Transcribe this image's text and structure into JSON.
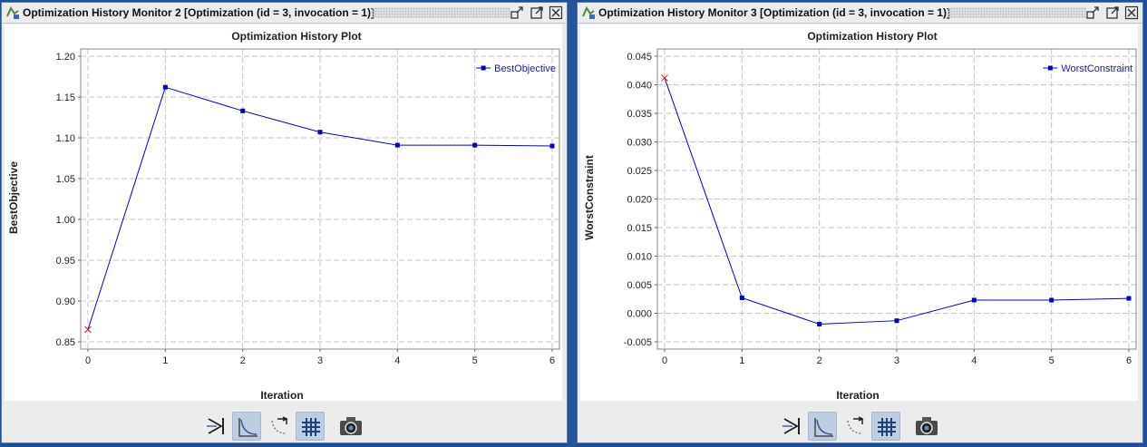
{
  "windows": [
    {
      "title": "Optimization History Monitor 2 [Optimization (id = 3, invocation = 1)]",
      "chart_data": {
        "type": "line",
        "title": "Optimization History Plot",
        "xlabel": "Iteration",
        "ylabel": "BestObjective",
        "x": [
          0,
          1,
          2,
          3,
          4,
          5,
          6
        ],
        "series": [
          {
            "name": "BestObjective",
            "values": [
              0.865,
              1.162,
              1.133,
              1.107,
              1.091,
              1.091,
              1.09
            ],
            "color": "#0000c8"
          }
        ],
        "xlim": [
          0,
          6
        ],
        "ylim": [
          0.85,
          1.2
        ],
        "x_ticks": [
          "0",
          "1",
          "2",
          "3",
          "4",
          "5",
          "6"
        ],
        "y_ticks": [
          "0.85",
          "0.90",
          "0.95",
          "1.00",
          "1.05",
          "1.10",
          "1.15",
          "1.20"
        ],
        "grid": true,
        "legend": "top-right",
        "first_point_marker": "cross",
        "first_marker_color": "#d02020"
      }
    },
    {
      "title": "Optimization History Monitor 3 [Optimization (id = 3, invocation = 1)]",
      "chart_data": {
        "type": "line",
        "title": "Optimization History Plot",
        "xlabel": "Iteration",
        "ylabel": "WorstConstraint",
        "x": [
          0,
          1,
          2,
          3,
          4,
          5,
          6
        ],
        "series": [
          {
            "name": "WorstConstraint",
            "values": [
              0.0412,
              0.0027,
              -0.0019,
              -0.0013,
              0.0023,
              0.0023,
              0.0026
            ],
            "color": "#0000c8"
          }
        ],
        "xlim": [
          0,
          6
        ],
        "ylim": [
          -0.005,
          0.045
        ],
        "x_ticks": [
          "0",
          "1",
          "2",
          "3",
          "4",
          "5",
          "6"
        ],
        "y_ticks": [
          "-0.005",
          "0.000",
          "0.005",
          "0.010",
          "0.015",
          "0.020",
          "0.025",
          "0.030",
          "0.035",
          "0.040",
          "0.045"
        ],
        "grid": true,
        "legend": "top-right",
        "first_point_marker": "cross",
        "first_marker_color": "#d02020"
      }
    }
  ],
  "toolbar_icons": [
    "zoom-tool-icon",
    "curve-plot-icon",
    "curve-pick-icon",
    "grid-toggle-icon",
    "camera-snapshot-icon"
  ]
}
